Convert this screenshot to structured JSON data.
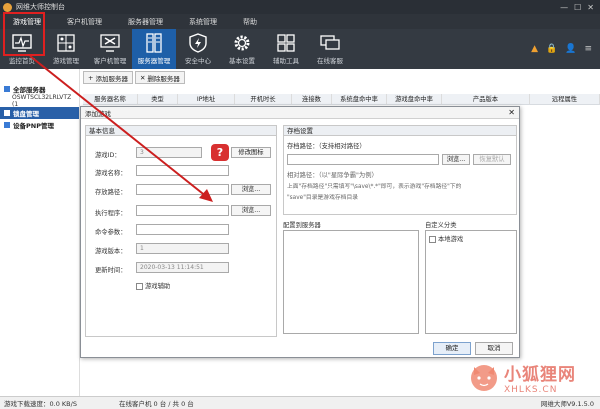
{
  "window": {
    "title": "网维大师控制台"
  },
  "menu": [
    "游戏管理",
    "客户机管理",
    "服务器管理",
    "系统管理",
    "帮助"
  ],
  "toolbar": [
    {
      "label": "监控首页",
      "icon": "monitor-icon"
    },
    {
      "label": "游戏管理",
      "icon": "game-icon"
    },
    {
      "label": "客户机管理",
      "icon": "client-icon"
    },
    {
      "label": "服务器管理",
      "icon": "server-icon"
    },
    {
      "label": "安全中心",
      "icon": "shield-icon"
    },
    {
      "label": "基本设置",
      "icon": "gear-icon"
    },
    {
      "label": "辅助工具",
      "icon": "tools-icon"
    },
    {
      "label": "在线客服",
      "icon": "chat-icon"
    }
  ],
  "subbar": {
    "add": "添加服务器",
    "delete": "删除服务器"
  },
  "leftpanel": {
    "all_servers": "全部服务器",
    "server_node": "OSWTSCL32LRLVTZ (1",
    "lock_manage": "锁盘管理",
    "pnp_manage": "设备PNP管理"
  },
  "table_headers": [
    "服务器名称",
    "类型",
    "IP地址",
    "开机时长",
    "连接数",
    "系统盘命中率",
    "游戏盘命中率",
    "产品版本",
    "远程属性"
  ],
  "status": {
    "speed": "游戏下载速度：0.0 KB/S",
    "clients": "在线客户机 0 台 / 共 0 台",
    "version": "网维大师V9.1.5.0"
  },
  "dialog": {
    "title": "添加游戏",
    "basic": {
      "header": "基本信息",
      "game_id_label": "游戏ID：",
      "game_id_value": "3",
      "modify_icon": "修改图标",
      "game_name_label": "游戏名称：",
      "store_path_label": "存放路径：",
      "exec_label": "执行程序：",
      "cmd_label": "命令参数：",
      "version_label": "游戏版本：",
      "version_value": "1",
      "update_label": "更新时间：",
      "update_value": "2020-03-13 11:14:51",
      "browse": "浏览...",
      "aux_label": "游戏辅助"
    },
    "storage": {
      "header": "存档设置",
      "path_label": "存档路径：（支持相对路径）",
      "browse": "浏览...",
      "reset": "恢复默认",
      "rel_example": "相对路径：（以\"星际争霸\"为例）",
      "note1": "上面\"存档路径\"只需填写\"\\save\\*.*\"即可，表示游戏\"存档路径\"下的",
      "note2": "\"save\"目录是游戏存档目录"
    },
    "config_server": "配置到服务器",
    "custom_category": "自定义分类",
    "local_game": "本地游戏",
    "ok": "确定",
    "cancel": "取消"
  },
  "watermark": {
    "cn": "小狐狸网",
    "en": "XHLKS.CN"
  },
  "colors": {
    "accent": "#1e5fa8",
    "highlight_box": "#e02020",
    "arrow": "#cc1f1f"
  }
}
